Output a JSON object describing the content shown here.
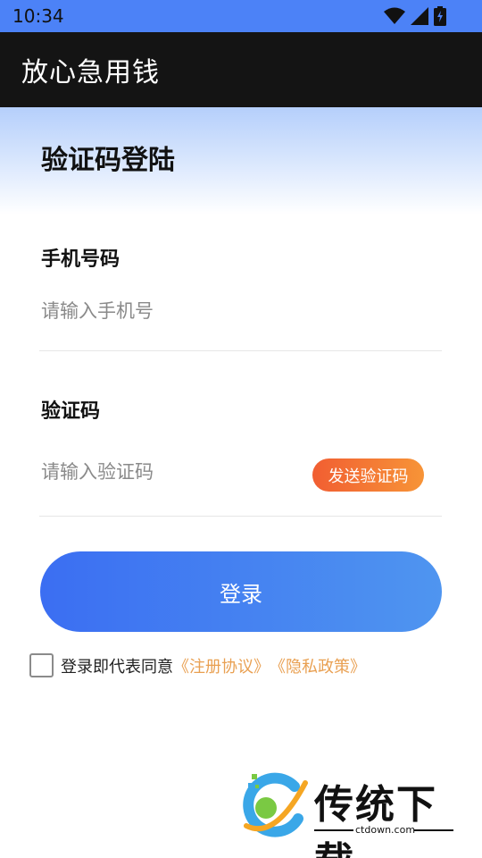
{
  "status_bar": {
    "time": "10:34",
    "icons": [
      "wifi-icon",
      "signal-icon",
      "battery-icon"
    ]
  },
  "app_bar": {
    "title": "放心急用钱"
  },
  "page": {
    "title": "验证码登陆"
  },
  "phone": {
    "label": "手机号码",
    "placeholder": "请输入手机号",
    "value": ""
  },
  "code": {
    "label": "验证码",
    "placeholder": "请输入验证码",
    "value": "",
    "send_button_label": "发送验证码"
  },
  "login_button_label": "登录",
  "agreement": {
    "checked": false,
    "text": "登录即代表同意",
    "terms_link": "《注册协议》",
    "privacy_link": "《隐私政策》"
  },
  "watermark": {
    "title": "传统下载",
    "subtitle": "ctdown.com"
  },
  "colors": {
    "status_bar": "#4c82f7",
    "app_bar": "#141414",
    "login_gradient_start": "#3b6ef2",
    "login_gradient_end": "#4f95f0",
    "send_gradient_start": "#f15e32",
    "send_gradient_end": "#f79437",
    "link": "#e9a052"
  }
}
